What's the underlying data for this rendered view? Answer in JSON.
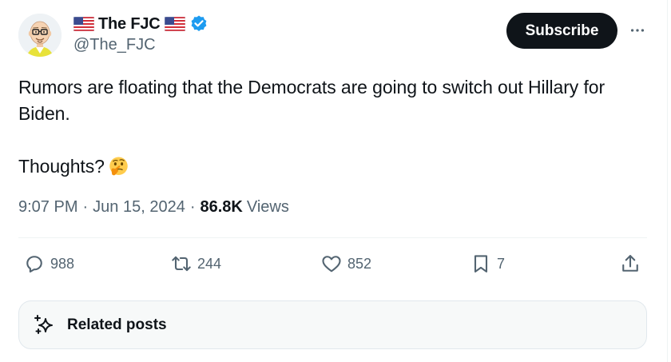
{
  "author": {
    "display_name": "The FJC",
    "handle": "@The_FJC",
    "verified": true,
    "flag_icon": "us-flag-icon",
    "avatar": "cartoon-bald-man-with-glasses-avatar"
  },
  "header": {
    "subscribe_label": "Subscribe",
    "more_icon": "more-horizontal-icon"
  },
  "tweet": {
    "line1": "Rumors are floating that the Democrats are going to switch out Hillary for Biden.",
    "line2": "Thoughts?",
    "emoji": "thinking-face-emoji"
  },
  "meta": {
    "time": "9:07 PM",
    "separator": "·",
    "date": "Jun 15, 2024",
    "views_count": "86.8K",
    "views_label": "Views"
  },
  "actions": {
    "replies": "988",
    "reposts": "244",
    "likes": "852",
    "bookmarks": "7"
  },
  "related": {
    "label": "Related posts"
  },
  "colors": {
    "text_primary": "#0f1419",
    "text_secondary": "#536471",
    "verified_blue": "#1d9bf0",
    "button_dark": "#0f1419",
    "divider": "#eff3f4"
  }
}
